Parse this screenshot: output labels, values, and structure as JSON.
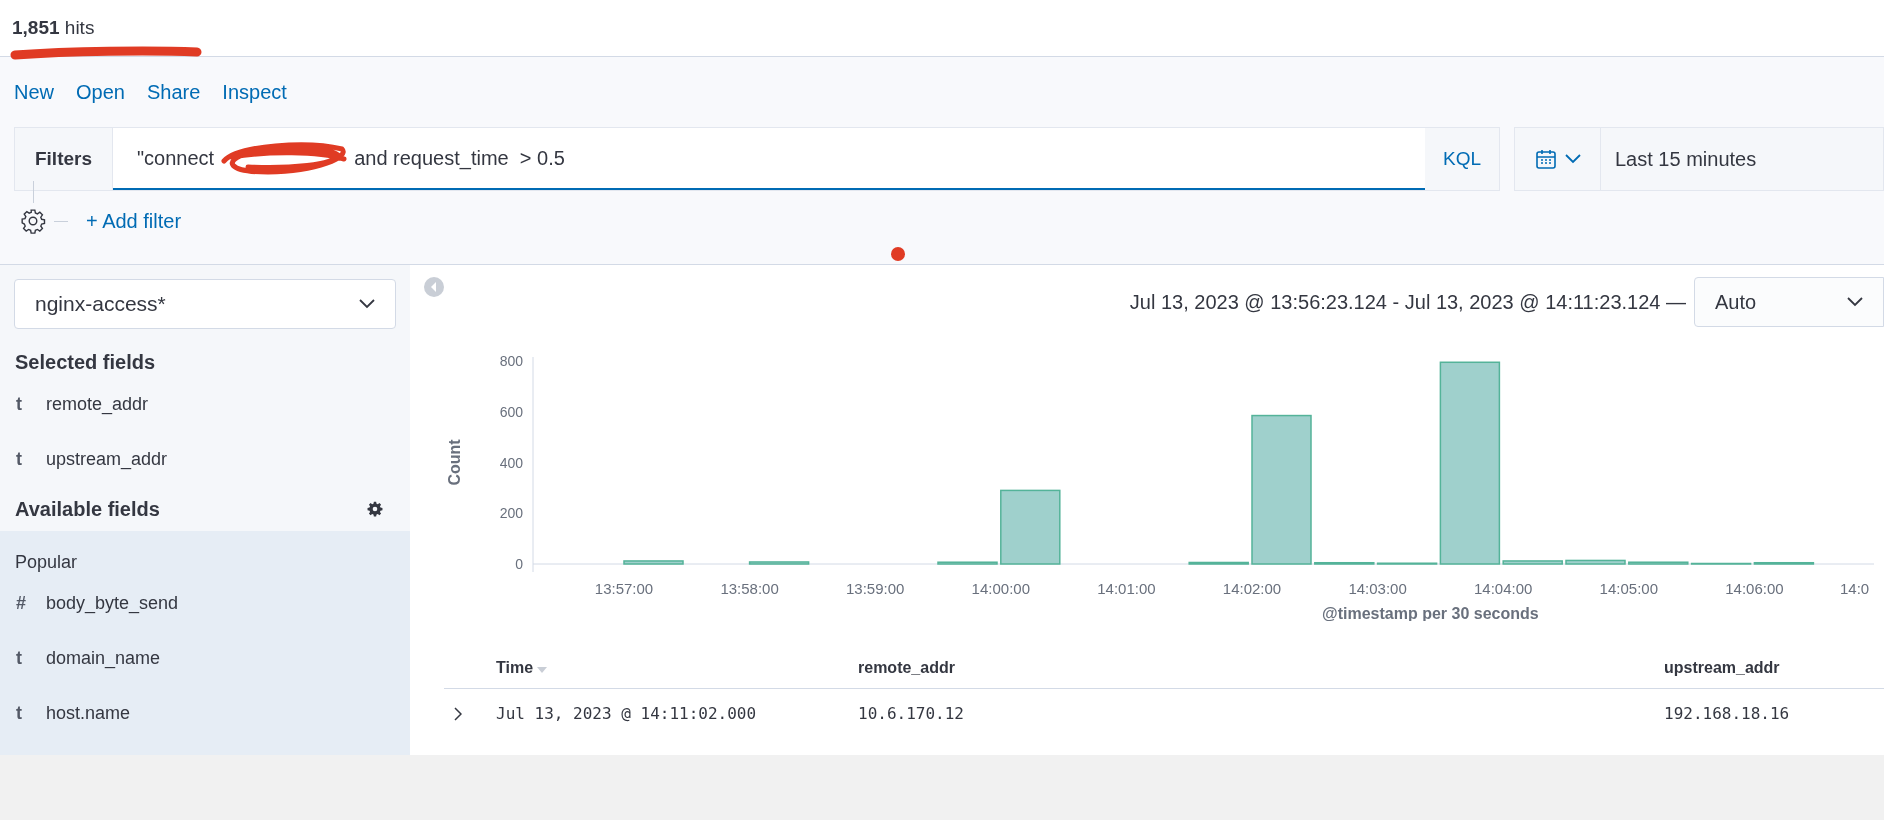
{
  "hits": {
    "count": "1,851",
    "label": "hits"
  },
  "nav_links": [
    "New",
    "Open",
    "Share",
    "Inspect"
  ],
  "query_bar": {
    "label": "Filters",
    "query_start": "\"connect",
    "query_end": "and request_time  > 0.5",
    "language": "KQL"
  },
  "time_picker": {
    "range": "Last 15 minutes"
  },
  "add_filter": "+ Add filter",
  "sidebar": {
    "index_pattern": "nginx-access*",
    "selected_title": "Selected fields",
    "selected_fields": [
      {
        "type_glyph": "t",
        "name": "remote_addr"
      },
      {
        "type_glyph": "t",
        "name": "upstream_addr"
      }
    ],
    "available_title": "Available fields",
    "popular_title": "Popular",
    "popular_fields": [
      {
        "type_glyph": "#",
        "name": "body_byte_send"
      },
      {
        "type_glyph": "t",
        "name": "domain_name"
      },
      {
        "type_glyph": "t",
        "name": "host.name"
      }
    ]
  },
  "histogram": {
    "range": "Jul 13, 2023 @ 13:56:23.124 - Jul 13, 2023 @ 14:11:23.124 —",
    "interval": "Auto",
    "chart_data": {
      "type": "bar",
      "xlabel": "@timestamp per 30 seconds",
      "ylabel": "Count",
      "categories": [
        "13:57:00",
        null,
        "13:58:00",
        null,
        "13:59:00",
        null,
        "14:00:00",
        null,
        "14:01:00",
        null,
        "14:02:00",
        null,
        "14:03:00",
        null,
        "14:04:00",
        null,
        "14:05:00",
        null,
        "14:06:00",
        null,
        "14:0"
      ],
      "values": [
        12,
        0,
        8,
        0,
        0,
        7,
        290,
        0,
        0,
        6,
        585,
        5,
        3,
        795,
        12,
        14,
        7,
        2,
        5,
        0,
        null
      ],
      "ylim": [
        0,
        800
      ],
      "yticks": [
        0,
        200,
        400,
        600,
        800
      ]
    }
  },
  "table": {
    "columns": [
      "Time",
      "remote_addr",
      "upstream_addr"
    ],
    "rows": [
      {
        "expanded": false,
        "cells": [
          "Jul 13, 2023 @ 14:11:02.000",
          "10.6.170.12",
          "192.168.18.16"
        ]
      }
    ]
  }
}
